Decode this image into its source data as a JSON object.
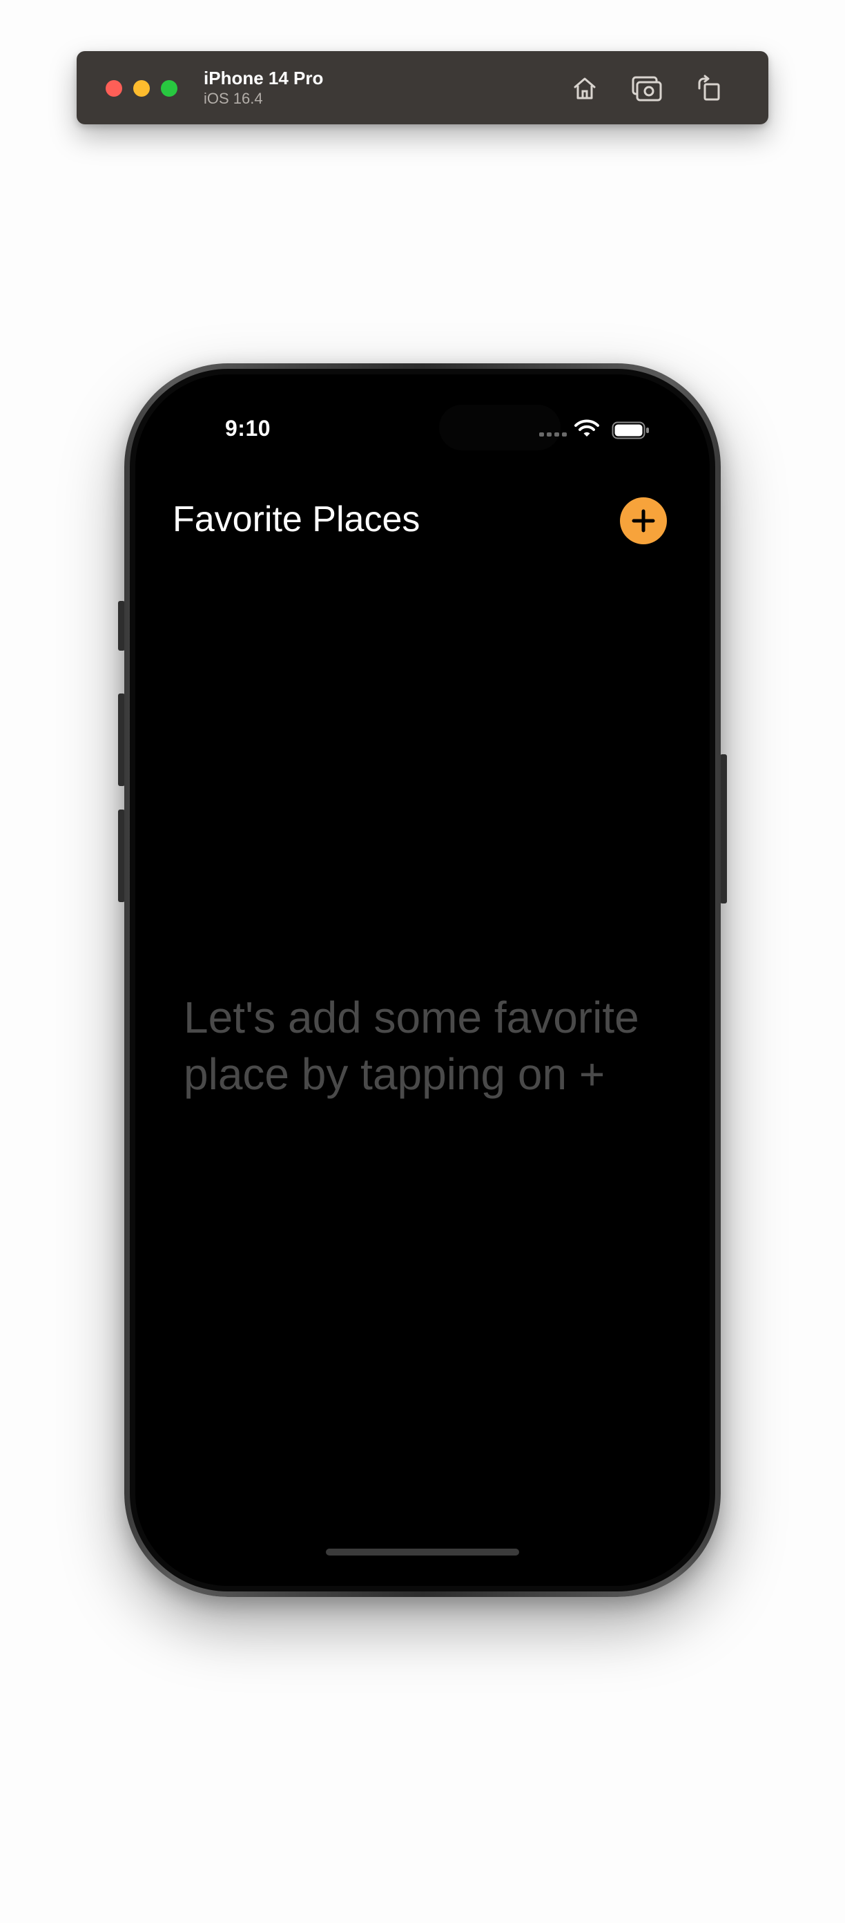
{
  "simulator": {
    "device_name": "iPhone 14 Pro",
    "os_version": "iOS 16.4",
    "controls": {
      "home_icon": "home-icon",
      "screenshot_icon": "screenshot-icon",
      "rotate_icon": "rotate-icon"
    }
  },
  "status_bar": {
    "time": "9:10",
    "icons": [
      "signal-dots-icon",
      "wifi-icon",
      "battery-icon"
    ]
  },
  "app": {
    "title": "Favorite Places",
    "add_button_icon": "plus-icon",
    "empty_state_text": "Let's add some favorite place by tapping on +"
  },
  "colors": {
    "accent": "#f7a33b",
    "toolbar_bg": "#3d3936",
    "screen_bg": "#000000",
    "empty_text": "#4a4a4a"
  }
}
